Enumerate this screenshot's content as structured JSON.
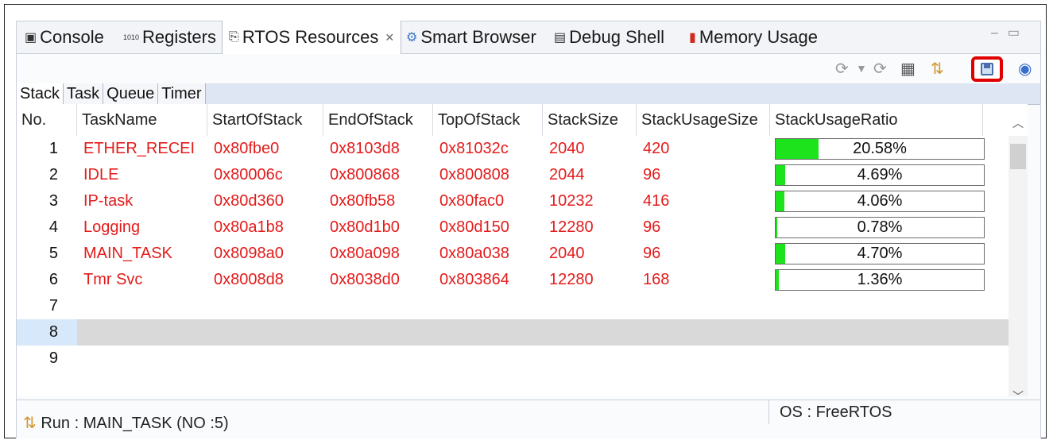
{
  "tabs": [
    {
      "label": "Console",
      "icon": "console-icon"
    },
    {
      "label": "Registers",
      "icon": "registers-icon"
    },
    {
      "label": "RTOS Resources",
      "icon": "rtos-icon",
      "active": true
    },
    {
      "label": "Smart Browser",
      "icon": "smart-browser-icon"
    },
    {
      "label": "Debug Shell",
      "icon": "debug-shell-icon"
    },
    {
      "label": "Memory Usage",
      "icon": "memory-usage-icon"
    }
  ],
  "subtabs": [
    "Stack",
    "Task",
    "Queue",
    "Timer"
  ],
  "columns": [
    "No.",
    "TaskName",
    "StartOfStack",
    "EndOfStack",
    "TopOfStack",
    "StackSize",
    "StackUsageSize",
    "StackUsageRatio"
  ],
  "rows": [
    {
      "no": "1",
      "name": "ETHER_RECEI",
      "start": "0x80fbe0",
      "end": "0x8103d8",
      "top": "0x81032c",
      "size": "2040",
      "usage": "420",
      "ratio": "20.58%",
      "ratio_value": 20.58
    },
    {
      "no": "2",
      "name": "IDLE",
      "start": "0x80006c",
      "end": "0x800868",
      "top": "0x800808",
      "size": "2044",
      "usage": "96",
      "ratio": "4.69%",
      "ratio_value": 4.69
    },
    {
      "no": "3",
      "name": "IP-task",
      "start": "0x80d360",
      "end": "0x80fb58",
      "top": "0x80fac0",
      "size": "10232",
      "usage": "416",
      "ratio": "4.06%",
      "ratio_value": 4.06
    },
    {
      "no": "4",
      "name": "Logging",
      "start": "0x80a1b8",
      "end": "0x80d1b0",
      "top": "0x80d150",
      "size": "12280",
      "usage": "96",
      "ratio": "0.78%",
      "ratio_value": 0.78
    },
    {
      "no": "5",
      "name": "MAIN_TASK",
      "start": "0x8098a0",
      "end": "0x80a098",
      "top": "0x80a038",
      "size": "2040",
      "usage": "96",
      "ratio": "4.70%",
      "ratio_value": 4.7
    },
    {
      "no": "6",
      "name": "Tmr Svc",
      "start": "0x8008d8",
      "end": "0x8038d0",
      "top": "0x803864",
      "size": "12280",
      "usage": "168",
      "ratio": "1.36%",
      "ratio_value": 1.36
    },
    {
      "no": "7"
    },
    {
      "no": "8",
      "selected": true
    },
    {
      "no": "9"
    }
  ],
  "status": {
    "left": "Run : MAIN_TASK (NO :5)",
    "right": "OS : FreeRTOS"
  },
  "colors": {
    "task_text": "#e41b1b",
    "bar_fill": "#1de31d",
    "save_highlight": "#e00000"
  }
}
